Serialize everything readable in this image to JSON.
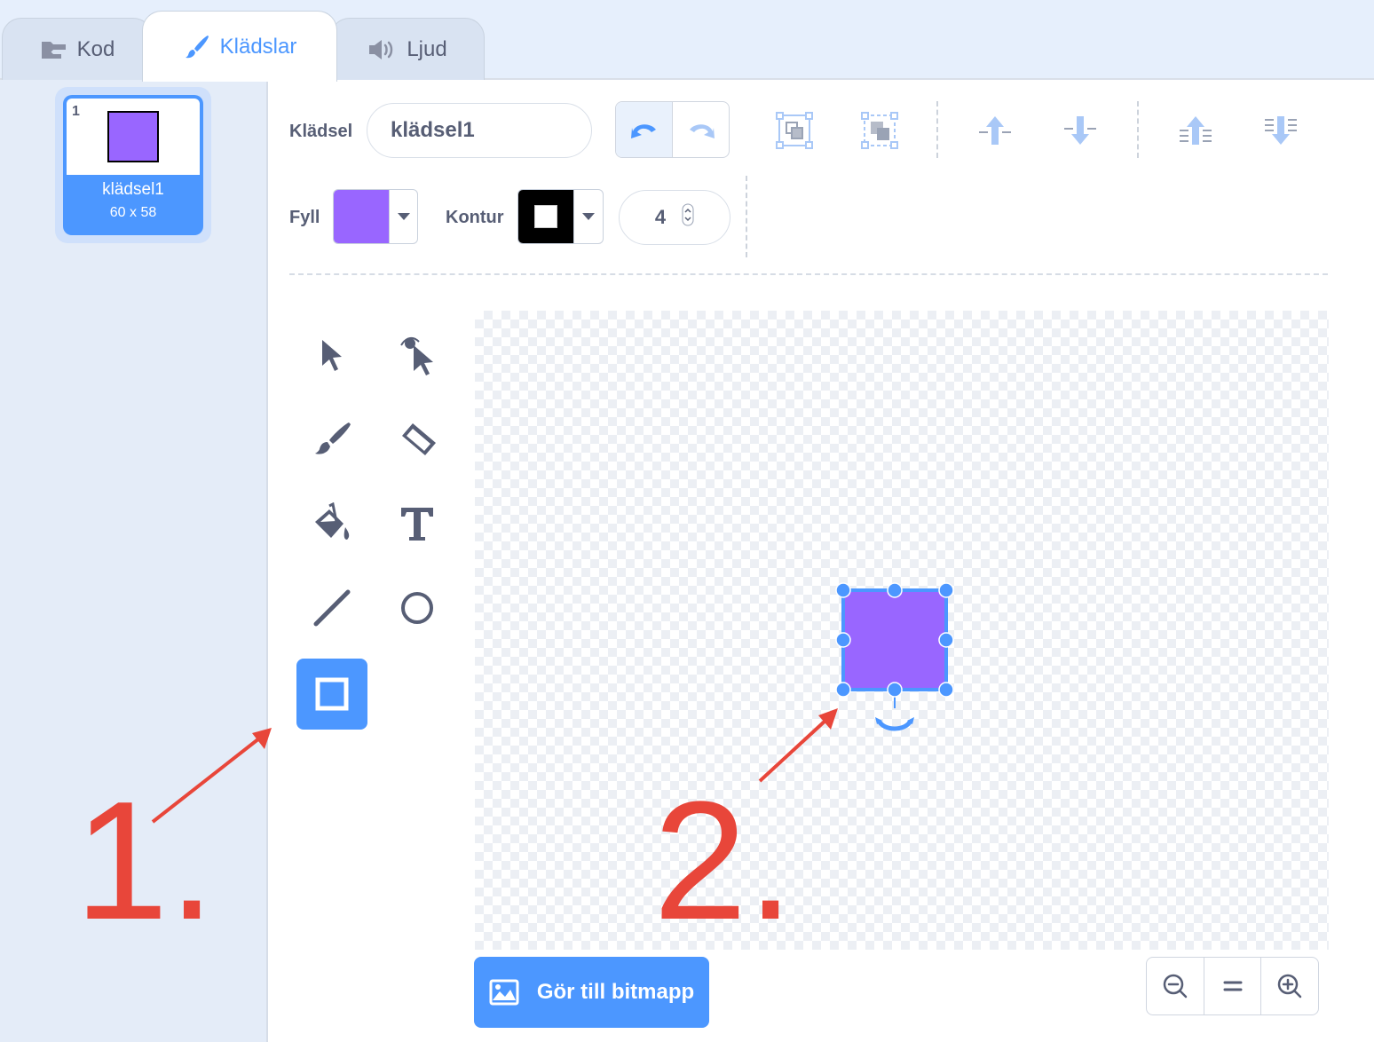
{
  "tabs": [
    {
      "label": "Kod",
      "icon": "code-icon",
      "active": false
    },
    {
      "label": "Klädslar",
      "icon": "brush-icon",
      "active": true
    },
    {
      "label": "Ljud",
      "icon": "speaker-icon",
      "active": false
    }
  ],
  "costume_list": [
    {
      "number": "1",
      "name": "klädsel1",
      "size": "60 x 58",
      "selected": true
    }
  ],
  "toolbar": {
    "costume_label": "Klädsel",
    "costume_name": "klädsel1",
    "fill_label": "Fyll",
    "outline_label": "Kontur",
    "outline_width": "4",
    "fill_color": "#9966ff",
    "outline_color": "#000000",
    "buttons": [
      "undo-icon",
      "redo-icon",
      "group-icon",
      "ungroup-icon",
      "forward-icon",
      "backward-icon",
      "front-icon",
      "back-icon"
    ]
  },
  "tools": [
    "select-icon",
    "reshape-icon",
    "brush-icon",
    "eraser-icon",
    "fill-icon",
    "text-icon",
    "line-icon",
    "circle-icon",
    "rectangle-icon"
  ],
  "selected_tool": "rectangle-icon",
  "canvas": {
    "shape_fill": "#9966ff",
    "selection_color": "#4c97ff"
  },
  "bottom": {
    "convert_label": "Gör till bitmapp",
    "zoom": [
      "zoom-out-icon",
      "zoom-reset-icon",
      "zoom-in-icon"
    ]
  },
  "annotations": {
    "one": "1.",
    "two": "2.",
    "color": "#e8463a"
  }
}
